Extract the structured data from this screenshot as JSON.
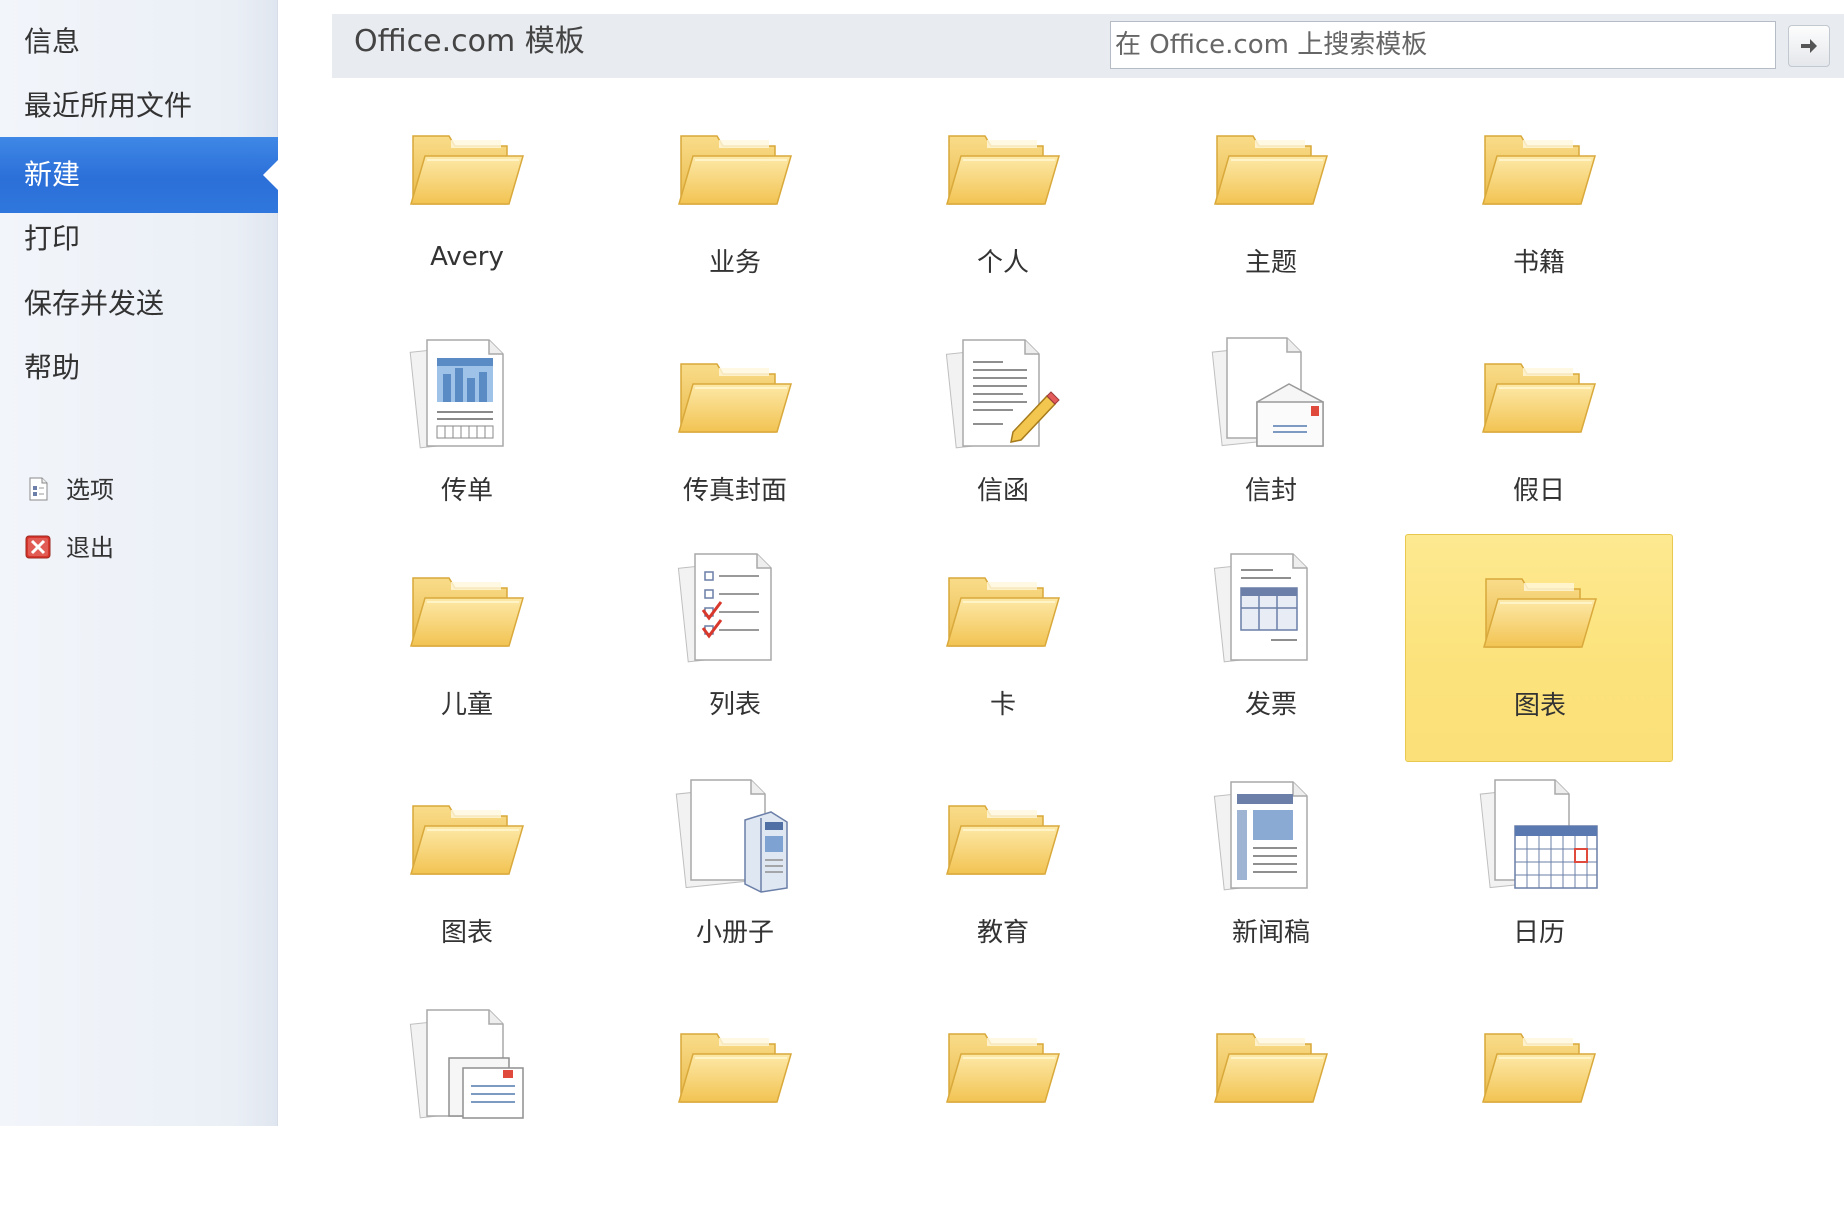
{
  "nav": {
    "items": [
      {
        "label": "信息",
        "id": "info"
      },
      {
        "label": "最近所用文件",
        "id": "recent"
      },
      {
        "label": "新建",
        "id": "new",
        "selected": true
      },
      {
        "label": "打印",
        "id": "print"
      },
      {
        "label": "保存并发送",
        "id": "save-send"
      },
      {
        "label": "帮助",
        "id": "help"
      }
    ],
    "commands": [
      {
        "label": "选项",
        "icon": "options-icon"
      },
      {
        "label": "退出",
        "icon": "exit-icon"
      }
    ]
  },
  "header": {
    "title": "Office.com 模板",
    "search_placeholder": "在 Office.com 上搜索模板",
    "go_icon": "arrow-right-icon"
  },
  "templates": [
    {
      "label": "Avery",
      "icon": "folder-icon"
    },
    {
      "label": "业务",
      "icon": "folder-icon"
    },
    {
      "label": "个人",
      "icon": "folder-icon"
    },
    {
      "label": "主题",
      "icon": "folder-icon"
    },
    {
      "label": "书籍",
      "icon": "folder-icon"
    },
    {
      "label": "传单",
      "icon": "flyer-icon"
    },
    {
      "label": "传真封面",
      "icon": "folder-icon"
    },
    {
      "label": "信函",
      "icon": "letter-icon"
    },
    {
      "label": "信封",
      "icon": "envelope-icon"
    },
    {
      "label": "假日",
      "icon": "folder-icon"
    },
    {
      "label": "儿童",
      "icon": "folder-icon"
    },
    {
      "label": "列表",
      "icon": "checklist-icon"
    },
    {
      "label": "卡",
      "icon": "folder-icon"
    },
    {
      "label": "发票",
      "icon": "invoice-icon"
    },
    {
      "label": "图表",
      "icon": "folder-icon",
      "selected": true
    },
    {
      "label": "图表",
      "icon": "folder-icon"
    },
    {
      "label": "小册子",
      "icon": "brochure-icon"
    },
    {
      "label": "教育",
      "icon": "folder-icon"
    },
    {
      "label": "新闻稿",
      "icon": "newsletter-icon"
    },
    {
      "label": "日历",
      "icon": "calendar-icon"
    },
    {
      "label": "",
      "icon": "document-set-icon"
    },
    {
      "label": "",
      "icon": "folder-icon"
    },
    {
      "label": "",
      "icon": "folder-icon"
    },
    {
      "label": "",
      "icon": "folder-icon"
    },
    {
      "label": "",
      "icon": "folder-icon"
    }
  ],
  "colors": {
    "accent": "#2b6fd8",
    "selected_tile": "#fce27a",
    "folder": "#f7c95a"
  }
}
